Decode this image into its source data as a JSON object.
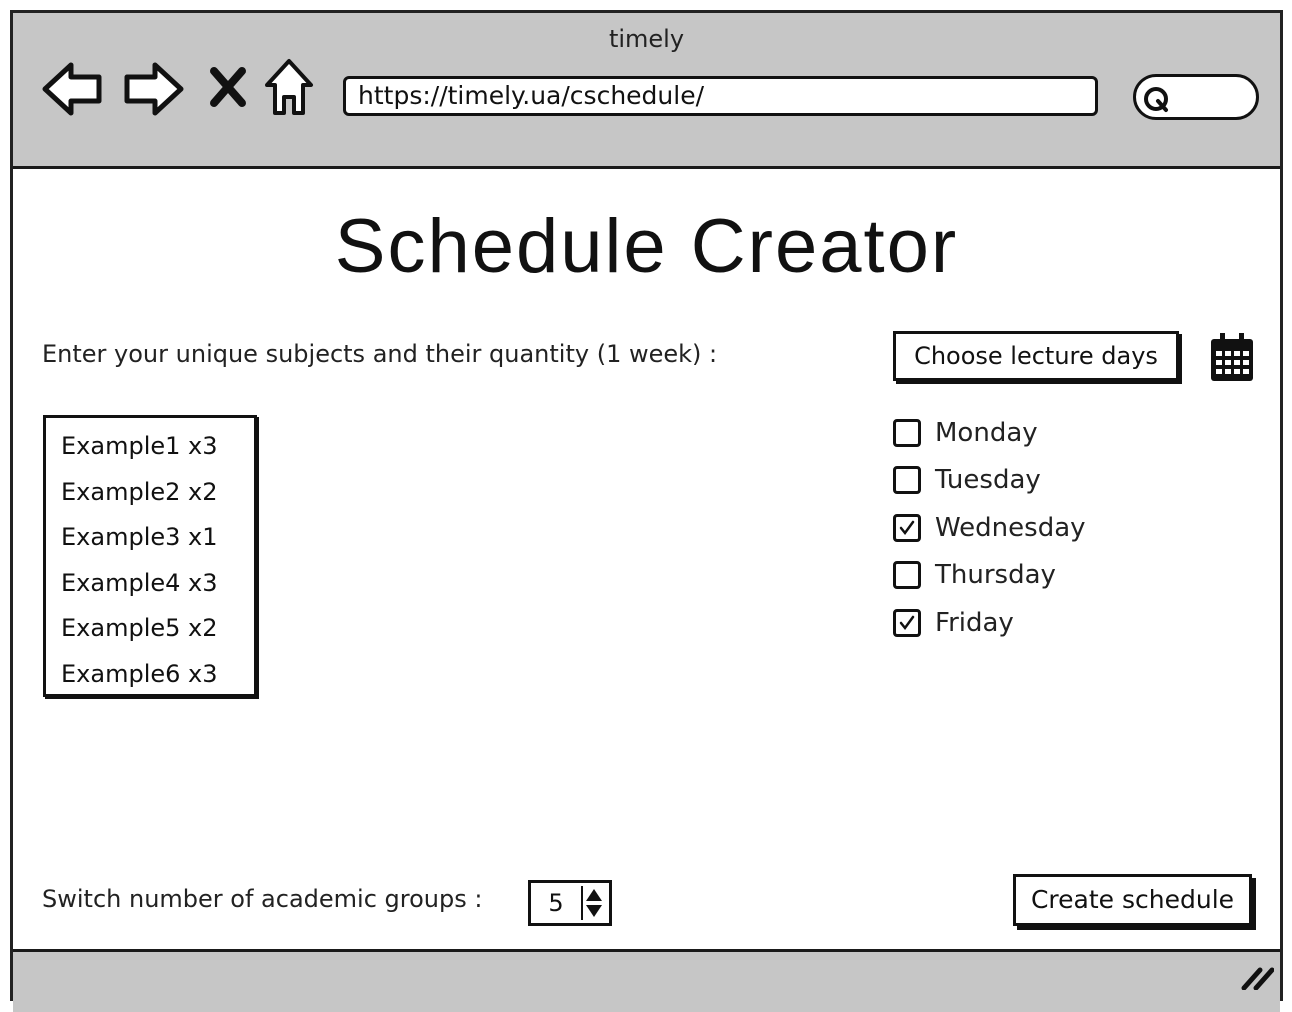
{
  "window": {
    "title": "timely",
    "url": "https://timely.ua/cschedule/",
    "nav_icons": [
      "back-arrow-icon",
      "forward-arrow-icon",
      "close-icon",
      "home-icon"
    ],
    "search_icon": "search-icon"
  },
  "page": {
    "title": "Schedule Creator",
    "subjects_prompt": "Enter your unique subjects and their quantity (1 week) :",
    "subjects": [
      "Example1 x3",
      "Example2 x2",
      "Example3 x1",
      "Example4 x3",
      "Example5 x2",
      "Example6 x3"
    ],
    "days_button_label": "Choose lecture days",
    "calendar_icon": "calendar-icon",
    "days": [
      {
        "label": "Monday",
        "checked": false
      },
      {
        "label": "Tuesday",
        "checked": false
      },
      {
        "label": "Wednesday",
        "checked": true
      },
      {
        "label": "Thursday",
        "checked": false
      },
      {
        "label": "Friday",
        "checked": true
      }
    ],
    "groups_label": "Switch number of academic groups :",
    "groups_value": "5",
    "create_button_label": "Create schedule"
  }
}
